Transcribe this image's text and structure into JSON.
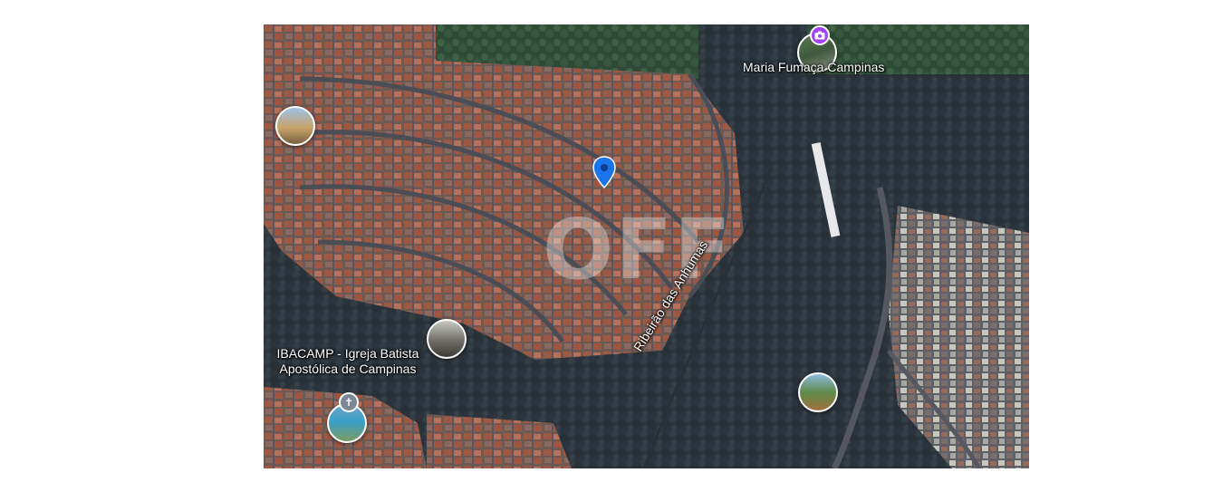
{
  "map": {
    "type": "satellite",
    "watermark": "OFF",
    "labels": {
      "poi_top": "Maria Fumaça Campinas",
      "poi_church_line1": "IBACAMP - Igreja Batista",
      "poi_church_line2": "Apostólica de Campinas",
      "river": "Ribeirão das Anhumas"
    },
    "markers": [
      {
        "name": "location-pin",
        "color": "#1a73e8"
      }
    ],
    "icons": {
      "camera_badge": "camera-icon",
      "cross_badge": "cross-icon"
    },
    "colors": {
      "pin": "#1a73e8",
      "camera_badge": "#a142f4",
      "cross_badge": "#7b8794"
    }
  }
}
